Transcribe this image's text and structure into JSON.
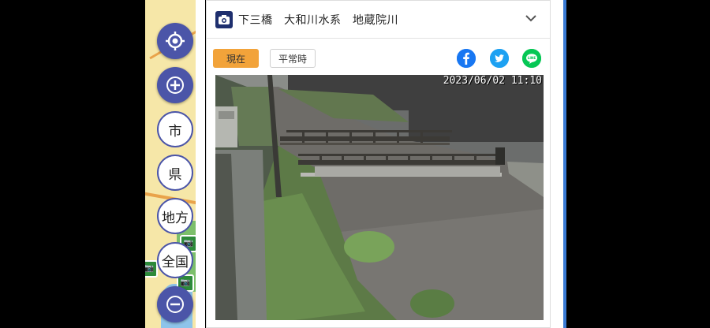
{
  "camera": {
    "title": "下三橋　大和川水系　地蔵院川",
    "timestamp": "2023/06/02  11:10"
  },
  "buttons": {
    "now_label": "現在",
    "normal_label": "平常時"
  },
  "map_controls": {
    "city_label": "市",
    "prefecture_label": "県",
    "region_label": "地方",
    "nation_label": "全国"
  },
  "share": {
    "facebook_color": "#1877f2",
    "twitter_color": "#1da1f2",
    "line_color": "#06c755",
    "line_label": "LINE"
  },
  "colors": {
    "control_blue": "#4b55a8",
    "active_button": "#f2a33a"
  }
}
